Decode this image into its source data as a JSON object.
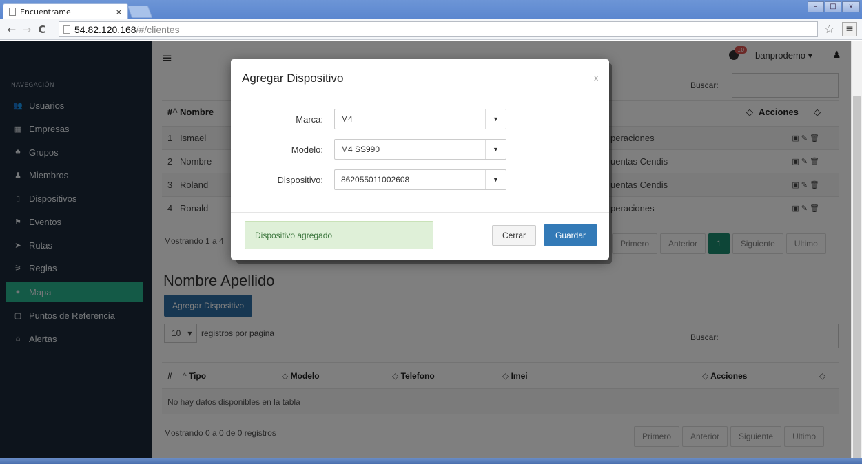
{
  "browser": {
    "tab_title": "Encuentrame",
    "tab_close": "×",
    "url_host": "54.82.120.168",
    "url_path": "/#/clientes",
    "back": "←",
    "forward": "→",
    "reload": "C",
    "star": "☆",
    "menu": "≡"
  },
  "header": {
    "hamburger": "≡",
    "notifications": "10",
    "user": "banprodemo ▾"
  },
  "sidebar": {
    "heading": "NAVEGACIÓN",
    "items": [
      {
        "label": "Usuarios",
        "icon": "users-icon",
        "glyph": "👥"
      },
      {
        "label": "Empresas",
        "icon": "building-icon",
        "glyph": "▦"
      },
      {
        "label": "Grupos",
        "icon": "sitemap-icon",
        "glyph": "♣"
      },
      {
        "label": "Miembros",
        "icon": "user-icon",
        "glyph": "♟"
      },
      {
        "label": "Dispositivos",
        "icon": "mobile-icon",
        "glyph": "▯"
      },
      {
        "label": "Eventos",
        "icon": "flag-icon",
        "glyph": "⚑"
      },
      {
        "label": "Rutas",
        "icon": "location-arrow-icon",
        "glyph": "➤"
      },
      {
        "label": "Reglas",
        "icon": "rules-icon",
        "glyph": "⚞"
      },
      {
        "label": "Mapa",
        "icon": "map-marker-icon",
        "glyph": "●"
      },
      {
        "label": "Puntos de Referencia",
        "icon": "square-icon",
        "glyph": "▢"
      },
      {
        "label": "Alertas",
        "icon": "bell-icon",
        "glyph": "⌂"
      }
    ]
  },
  "upper": {
    "search_label": "Buscar:",
    "columns": {
      "num": "#^",
      "name": "Nombre",
      "actions": "Acciones"
    },
    "rows": [
      {
        "num": "1",
        "name": "Ismael",
        "group": "peraciones"
      },
      {
        "num": "2",
        "name": "Nombre",
        "group": "uentas Cendis"
      },
      {
        "num": "3",
        "name": "Roland",
        "group": "uentas Cendis"
      },
      {
        "num": "4",
        "name": "Ronald",
        "group": "peraciones"
      }
    ],
    "showing": "Mostrando 1 a 4",
    "pagination": [
      "Primero",
      "Anterior",
      "1",
      "Siguiente",
      "Ultimo"
    ]
  },
  "lower": {
    "title": "Nombre Apellido",
    "add_button": "Agregar Dispositivo",
    "length_value": "10",
    "length_label": "registros por pagina",
    "search_label": "Buscar:",
    "columns": [
      "#",
      "Tipo",
      "Modelo",
      "Telefono",
      "Imei",
      "Acciones"
    ],
    "empty": "No hay datos disponibles en la tabla",
    "showing": "Mostrando 0 a 0 de 0 registros",
    "pagination": [
      "Primero",
      "Anterior",
      "Siguiente",
      "Ultimo"
    ]
  },
  "modal": {
    "title": "Agregar Dispositivo",
    "close": "x",
    "fields": [
      {
        "label": "Marca:",
        "value": "M4"
      },
      {
        "label": "Modelo:",
        "value": "M4 SS990"
      },
      {
        "label": "Dispositivo:",
        "value": "862055011002608"
      }
    ],
    "alert": "Dispositivo agregado",
    "cancel": "Cerrar",
    "save": "Guardar"
  }
}
